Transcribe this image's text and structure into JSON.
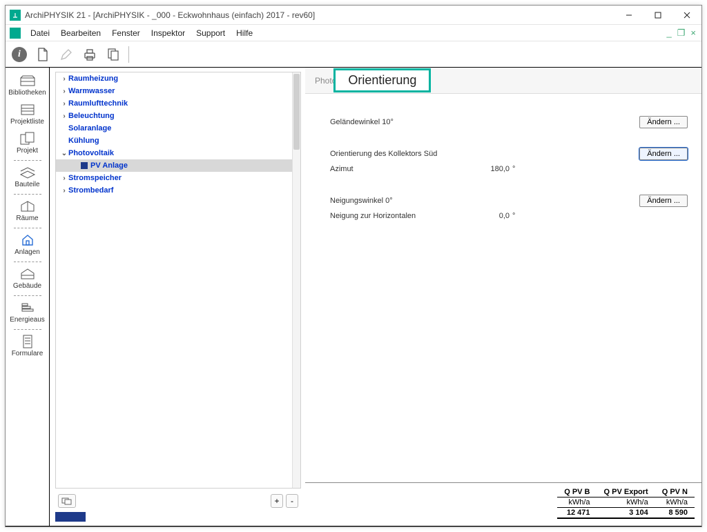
{
  "window": {
    "title": "ArchiPHYSIK 21 - [ArchiPHYSIK - _000 - Eckwohnhaus (einfach) 2017 - rev60]"
  },
  "menu": {
    "items": [
      "Datei",
      "Bearbeiten",
      "Fenster",
      "Inspektor",
      "Support",
      "Hilfe"
    ]
  },
  "sidebar": {
    "items": [
      {
        "label": "Bibliotheken"
      },
      {
        "label": "Projektliste"
      },
      {
        "label": "Projekt"
      },
      {
        "label": "Bauteile"
      },
      {
        "label": "Räume"
      },
      {
        "label": "Anlagen"
      },
      {
        "label": "Gebäude"
      },
      {
        "label": "Energieaus"
      },
      {
        "label": "Formulare"
      }
    ]
  },
  "tree": {
    "items": [
      {
        "label": "Raumheizung",
        "caret": "›"
      },
      {
        "label": "Warmwasser",
        "caret": "›"
      },
      {
        "label": "Raumlufttechnik",
        "caret": "›"
      },
      {
        "label": "Beleuchtung",
        "caret": "›"
      },
      {
        "label": "Solaranlage",
        "caret": ""
      },
      {
        "label": "Kühlung",
        "caret": ""
      },
      {
        "label": "Photovoltaik",
        "caret": "⌄"
      },
      {
        "label": "PV Anlage",
        "caret": "",
        "selected": true,
        "level": 3
      },
      {
        "label": "Stromspeicher",
        "caret": "›"
      },
      {
        "label": "Strombedarf",
        "caret": "›"
      }
    ]
  },
  "tabs": {
    "hidden_prefix": "Photo",
    "active": "Orientierung"
  },
  "detail": {
    "group1": {
      "label": "Geländewinkel 10°",
      "button": "Ändern ..."
    },
    "group2": {
      "line1_label": "Orientierung des Kollektors Süd",
      "line2_label": "Azimut",
      "line2_value": "180,0",
      "line2_unit": "°",
      "button": "Ändern ..."
    },
    "group3": {
      "line1_label": "Neigungswinkel 0°",
      "line2_label": "Neigung zur Horizontalen",
      "line2_value": "0,0",
      "line2_unit": "°",
      "button": "Ändern ..."
    }
  },
  "totals": {
    "headers": [
      "Q PV B",
      "Q PV Export",
      "Q PV N"
    ],
    "units": [
      "kWh/a",
      "kWh/a",
      "kWh/a"
    ],
    "values": [
      "12 471",
      "3 104",
      "8 590"
    ]
  },
  "buttons": {
    "plus": "+",
    "minus": "-"
  }
}
